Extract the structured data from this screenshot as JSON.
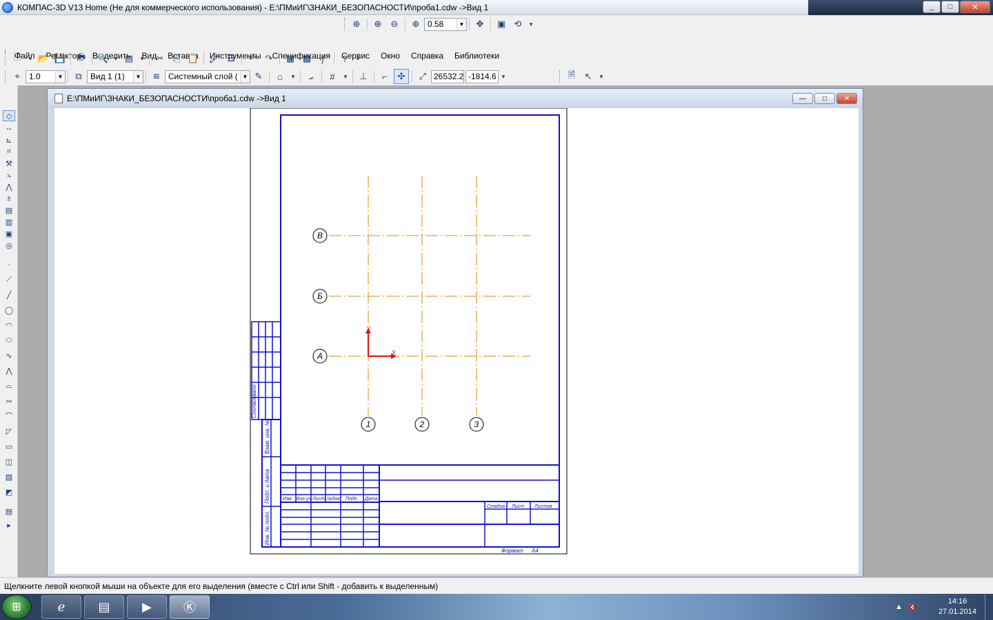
{
  "app": {
    "title": "КОМПАС-3D V13 Home (Не для коммерческого использования) - E:\\ПМиИГ\\ЗНАКИ_БЕЗОПАСНОСТИ\\проба1.cdw ->Вид 1"
  },
  "zoom_toolbar": {
    "zoom_value": "0.58"
  },
  "menu": {
    "items": [
      "Файл",
      "Редактор",
      "Выделить",
      "Вид",
      "Вставка",
      "Инструменты",
      "Спецификация",
      "Сервис",
      "Окно",
      "Справка",
      "Библиотеки"
    ]
  },
  "props_toolbar": {
    "step": "1.0",
    "view": "Вид 1 (1)",
    "layer": "Системный слой (",
    "coord_x": "26532.2",
    "coord_y": "-1814.6"
  },
  "document": {
    "title": "E:\\ПМиИГ\\ЗНАКИ_БЕЗОПАСНОСТИ\\проба1.cdw ->Вид 1"
  },
  "drawing": {
    "axis_labels_horizontal": [
      "В",
      "Б",
      "А"
    ],
    "axis_labels_vertical": [
      "1",
      "2",
      "3"
    ],
    "origin_x_label": "X",
    "origin_y_label": "Y",
    "stamp_headers": [
      "Изм",
      "Кол.уч",
      "Лист",
      "№док",
      "Подп.",
      "Дата"
    ],
    "stamp_right_headers": [
      "Стадия",
      "Лист",
      "Листов"
    ],
    "side_labels": [
      "Согласовано",
      "Взам. инв. №",
      "Подп. и дата",
      "Инв. № подл."
    ],
    "format_label": "Формат",
    "format_value": "А4"
  },
  "colors": {
    "frame": "#1010d0",
    "axis_line": "#e08a00",
    "origin": "#e01010"
  },
  "status": {
    "text": "Щелкните левой кнопкой мыши на объекте для его выделения (вместе с Ctrl или Shift - добавить к выделенным)"
  },
  "taskbar": {
    "time": "14:16",
    "date": "27.01.2014"
  }
}
